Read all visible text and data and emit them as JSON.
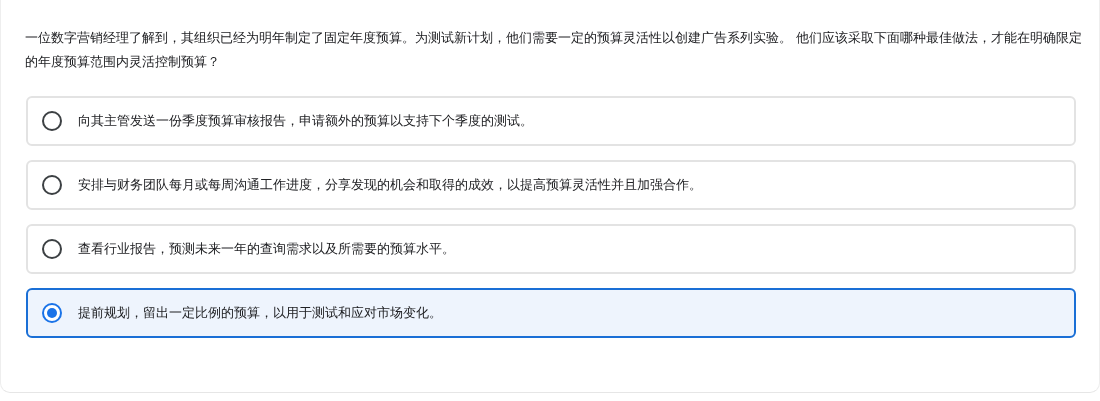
{
  "question": "一位数字营销经理了解到，其组织已经为明年制定了固定年度预算。为测试新计划，他们需要一定的预算灵活性以创建广告系列实验。 他们应该采取下面哪种最佳做法，才能在明确限定的年度预算范围内灵活控制预算？",
  "options": [
    {
      "label": "向其主管发送一份季度预算审核报告，申请额外的预算以支持下个季度的测试。",
      "selected": false
    },
    {
      "label": "安排与财务团队每月或每周沟通工作进度，分享发现的机会和取得的成效，以提高预算灵活性并且加强合作。",
      "selected": false
    },
    {
      "label": "查看行业报告，预测未来一年的查询需求以及所需要的预算水平。",
      "selected": false
    },
    {
      "label": "提前规划，留出一定比例的预算，以用于测试和应对市场变化。",
      "selected": true
    }
  ]
}
